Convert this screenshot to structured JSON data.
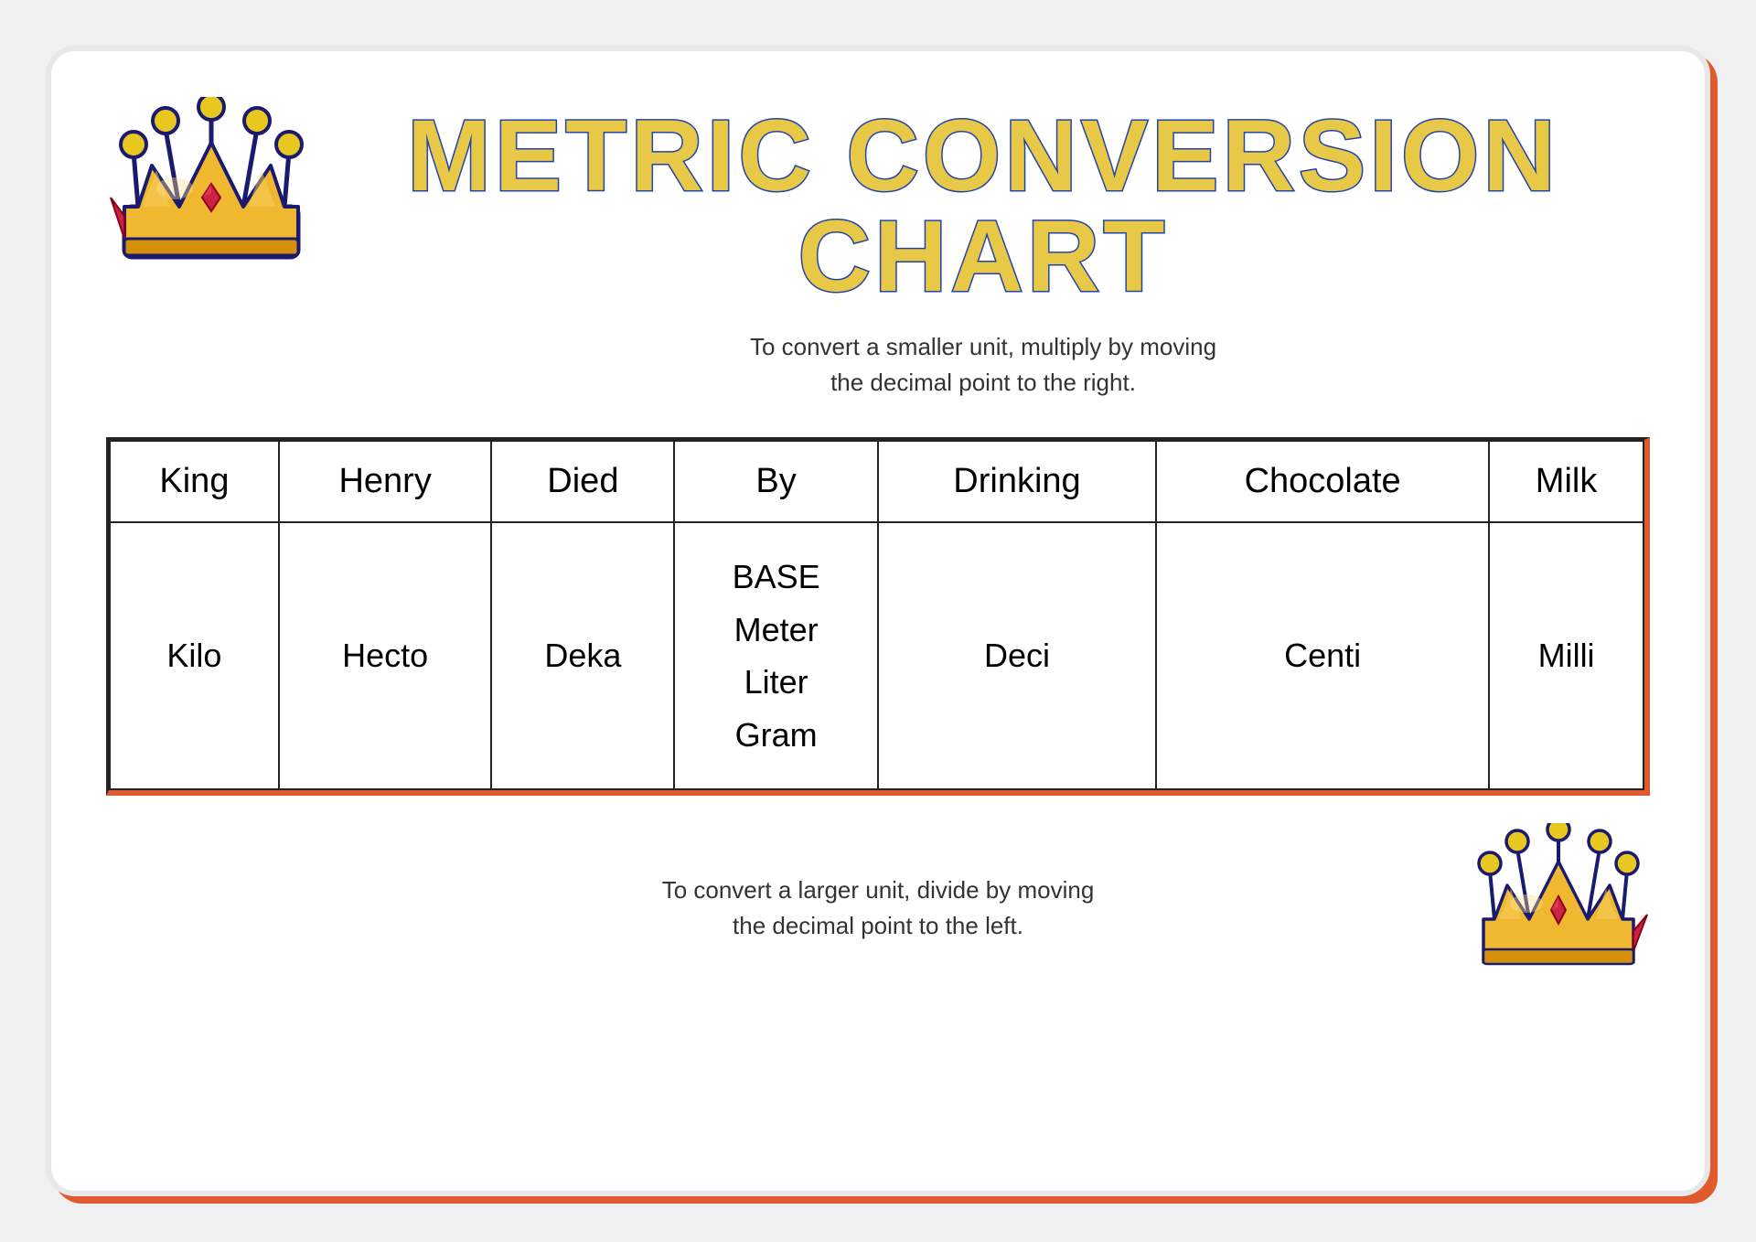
{
  "page": {
    "title": "METRIC CONVERSION CHART",
    "title_line1": "METRIC CONVERSION",
    "title_line2": "CHART",
    "subtitle": "To convert a smaller unit, multiply by moving\nthe decimal point to the right.",
    "bottom_text": "To convert a larger unit, divide by moving\nthe decimal point to the left.",
    "table": {
      "header_row": [
        "King",
        "Henry",
        "Died",
        "By",
        "Drinking",
        "Chocolate",
        "Milk"
      ],
      "data_row": [
        "Kilo",
        "Hecto",
        "Deka",
        "BASE\nMeter\nLiter\nGram",
        "Deci",
        "Centi",
        "Milli"
      ]
    }
  }
}
